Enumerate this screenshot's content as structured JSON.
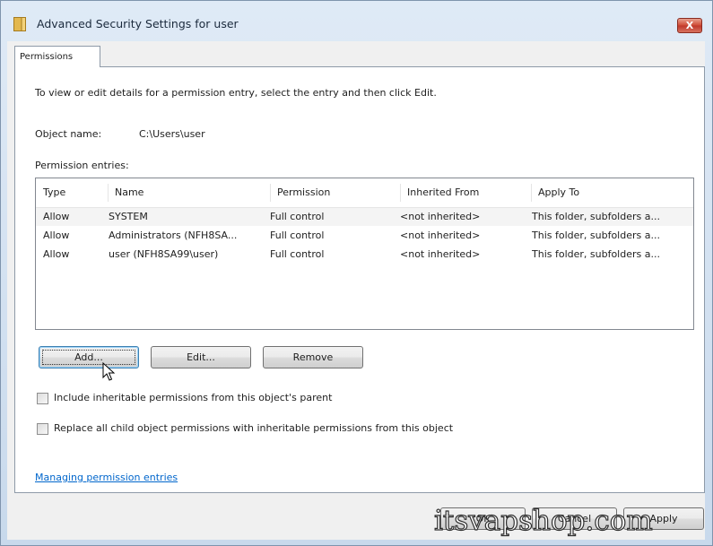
{
  "window": {
    "title": "Advanced Security Settings for user",
    "close_label": "X"
  },
  "tabs": [
    {
      "label": "Permissions",
      "active": true
    }
  ],
  "permissions": {
    "instruction": "To view or edit details for a permission entry, select the entry and then click Edit.",
    "object_name_label": "Object name:",
    "object_name_value": "C:\\Users\\user",
    "entries_label": "Permission entries:",
    "columns": [
      "Type",
      "Name",
      "Permission",
      "Inherited From",
      "Apply To"
    ],
    "rows": [
      {
        "type": "Allow",
        "name": "SYSTEM",
        "permission": "Full control",
        "inherited_from": "<not inherited>",
        "apply_to": "This folder, subfolders a...",
        "selected": true
      },
      {
        "type": "Allow",
        "name": "Administrators (NFH8SA...",
        "permission": "Full control",
        "inherited_from": "<not inherited>",
        "apply_to": "This folder, subfolders a...",
        "selected": false
      },
      {
        "type": "Allow",
        "name": "user (NFH8SA99\\user)",
        "permission": "Full control",
        "inherited_from": "<not inherited>",
        "apply_to": "This folder, subfolders a...",
        "selected": false
      }
    ],
    "buttons": {
      "add": "Add...",
      "edit": "Edit...",
      "remove": "Remove"
    },
    "checkboxes": [
      {
        "label": "Include inheritable permissions from this object's parent",
        "checked": false
      },
      {
        "label": "Replace all child object permissions with inheritable permissions from this object",
        "checked": false
      }
    ],
    "help_link": "Managing permission entries"
  },
  "footer": {
    "ok": "OK",
    "cancel": "Cancel",
    "apply": "Apply"
  },
  "watermark": "itsvapshop.com",
  "colors": {
    "close_button": "#cf4d37",
    "link": "#0066cc",
    "focus_border": "#3c7fb1"
  }
}
